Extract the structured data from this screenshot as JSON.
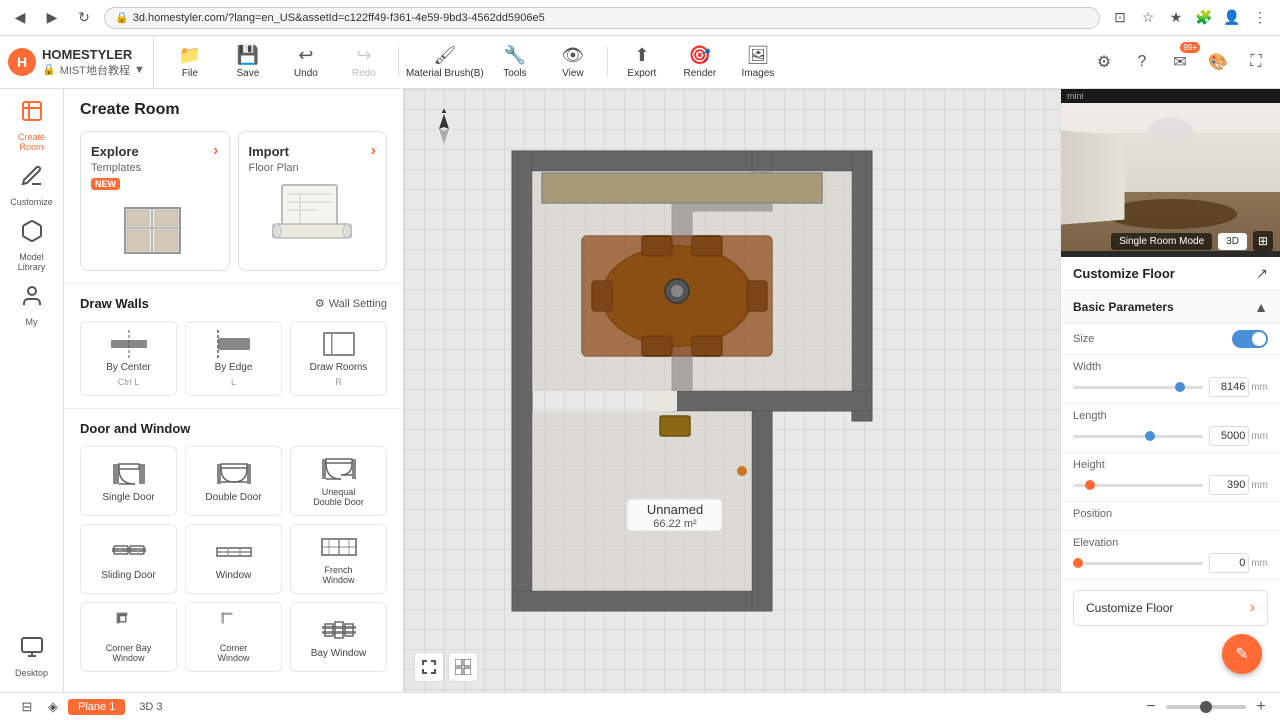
{
  "browser": {
    "back_btn": "◀",
    "forward_btn": "▶",
    "refresh_btn": "↻",
    "url": "3d.homestyler.com/?lang=en_US&assetId=c122ff49-f361-4e59-9bd3-4562dd5906e5",
    "lock_icon": "🔒"
  },
  "brand": {
    "name": "HOMESTYLER",
    "project_name": "MIST地台教程",
    "lock_icon": "🔒"
  },
  "toolbar": {
    "file_label": "File",
    "save_label": "Save",
    "undo_label": "Undo",
    "redo_label": "Redo",
    "material_brush_label": "Material Brush(B)",
    "tools_label": "Tools",
    "view_label": "View",
    "export_label": "Export",
    "render_label": "Render",
    "images_label": "Images"
  },
  "icon_sidebar": {
    "items": [
      {
        "id": "create-room",
        "label": "Create\nRoom",
        "icon": "⊞",
        "active": true
      },
      {
        "id": "customize",
        "label": "Customize",
        "icon": "✏️",
        "active": false
      },
      {
        "id": "model-library",
        "label": "Model\nLibrary",
        "icon": "📦",
        "active": false
      },
      {
        "id": "my",
        "label": "My",
        "icon": "👤",
        "active": false
      },
      {
        "id": "desktop",
        "label": "Desktop",
        "icon": "🖥",
        "active": false
      }
    ]
  },
  "create_room": {
    "title": "Create Room",
    "explore_label": "Explore",
    "explore_subtitle": "Templates",
    "explore_arrow": "›",
    "import_label": "Import",
    "import_subtitle": "Floor Plan",
    "import_arrow": "›",
    "new_badge": "NEW"
  },
  "draw_walls": {
    "title": "Draw Walls",
    "wall_setting_label": "Wall Setting",
    "gear_icon": "⚙",
    "tools": [
      {
        "id": "by-center",
        "label": "By Center",
        "shortcut": "Ctrl L"
      },
      {
        "id": "by-edge",
        "label": "By Edge",
        "shortcut": "L"
      },
      {
        "id": "draw-rooms",
        "label": "Draw Rooms",
        "shortcut": "R"
      }
    ]
  },
  "door_window": {
    "title": "Door and Window",
    "items": [
      {
        "id": "single-door",
        "label": "Single Door"
      },
      {
        "id": "double-door",
        "label": "Double Door"
      },
      {
        "id": "unequal-double-door",
        "label": "Unequal\nDouble Door"
      },
      {
        "id": "sliding-door",
        "label": "Sliding Door"
      },
      {
        "id": "window",
        "label": "Window"
      },
      {
        "id": "french-window",
        "label": "French\nWindow"
      },
      {
        "id": "corner-bay-window",
        "label": "Corner Bay\nWindow"
      },
      {
        "id": "corner-window",
        "label": "Corner\nWindow"
      },
      {
        "id": "bay-window",
        "label": "Bay Window"
      }
    ]
  },
  "canvas": {
    "room_name": "Unnamed",
    "room_area": "66.22 m²",
    "compass_symbol": "▲"
  },
  "bottom_bar": {
    "tab1_label": "Plane 1",
    "tab2_label": "3D 3",
    "zoom_in_icon": "+",
    "zoom_out_icon": "−",
    "zoom_value": 100
  },
  "right_panel": {
    "preview_label": "mini",
    "single_room_mode_label": "Single Room Mode",
    "mode_3d_label": "3D",
    "expand_icon": "⊞",
    "customize_floor_title": "Customize Floor",
    "expand_arrow": "↗",
    "basic_params_title": "Basic Parameters",
    "collapse_icon": "▲",
    "size_label": "Size",
    "width_label": "Width",
    "width_value": "8146",
    "width_unit": "mm",
    "length_label": "Length",
    "length_value": "5000",
    "length_unit": "mm",
    "height_label": "Height",
    "height_value": "390",
    "height_unit": "mm",
    "position_label": "Position",
    "elevation_label": "Elevation",
    "elevation_value": "0",
    "elevation_unit": "mm",
    "customize_floor_btn_label": "Customize Floor",
    "customize_floor_btn_arrow": "›"
  }
}
